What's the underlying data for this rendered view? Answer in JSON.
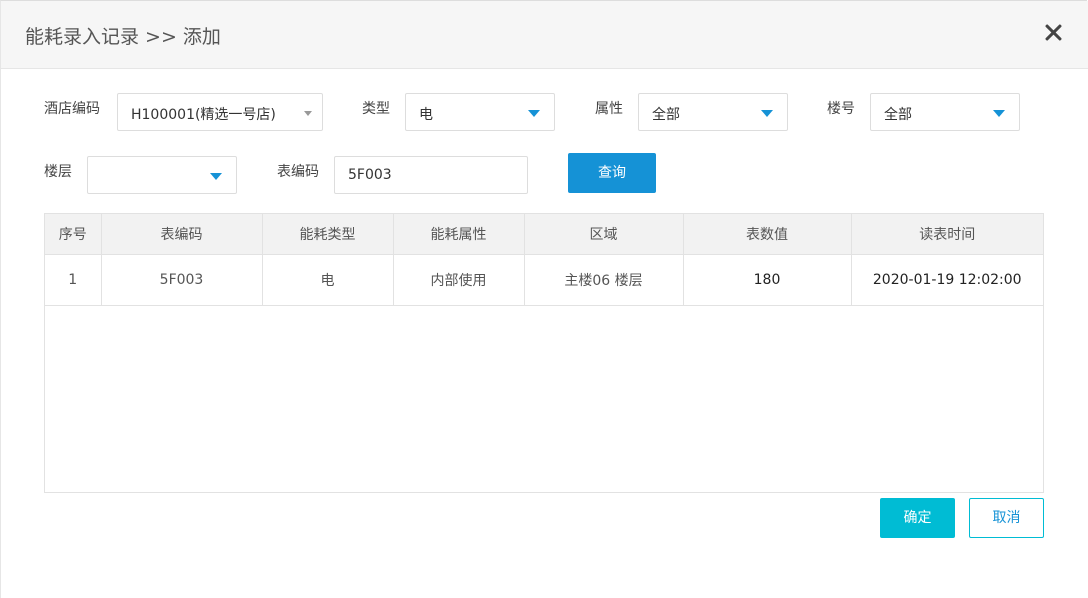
{
  "dialog": {
    "title": "能耗录入记录 >> 添加",
    "close_icon": "close-icon"
  },
  "filters": {
    "hotel_code_label": "酒店编码",
    "hotel_code_value": "H100001(精选一号店)",
    "type_label": "类型",
    "type_value": "电",
    "attr_label": "属性",
    "attr_value": "全部",
    "building_label": "楼号",
    "building_value": "全部",
    "floor_label": "楼层",
    "floor_value": "",
    "meter_code_label": "表编码",
    "meter_code_value": "5F003",
    "query_label": "查询"
  },
  "table": {
    "headers": [
      "序号",
      "表编码",
      "能耗类型",
      "能耗属性",
      "区域",
      "表数值",
      "读表时间"
    ],
    "rows": [
      [
        "1",
        "5F003",
        "电",
        "内部使用",
        "主楼06 楼层",
        "180",
        "2020-01-19 12:02:00"
      ]
    ]
  },
  "footer": {
    "ok_label": "确定",
    "cancel_label": "取消"
  },
  "colors": {
    "accent": "#1592d6",
    "confirm": "#00bcd4"
  }
}
